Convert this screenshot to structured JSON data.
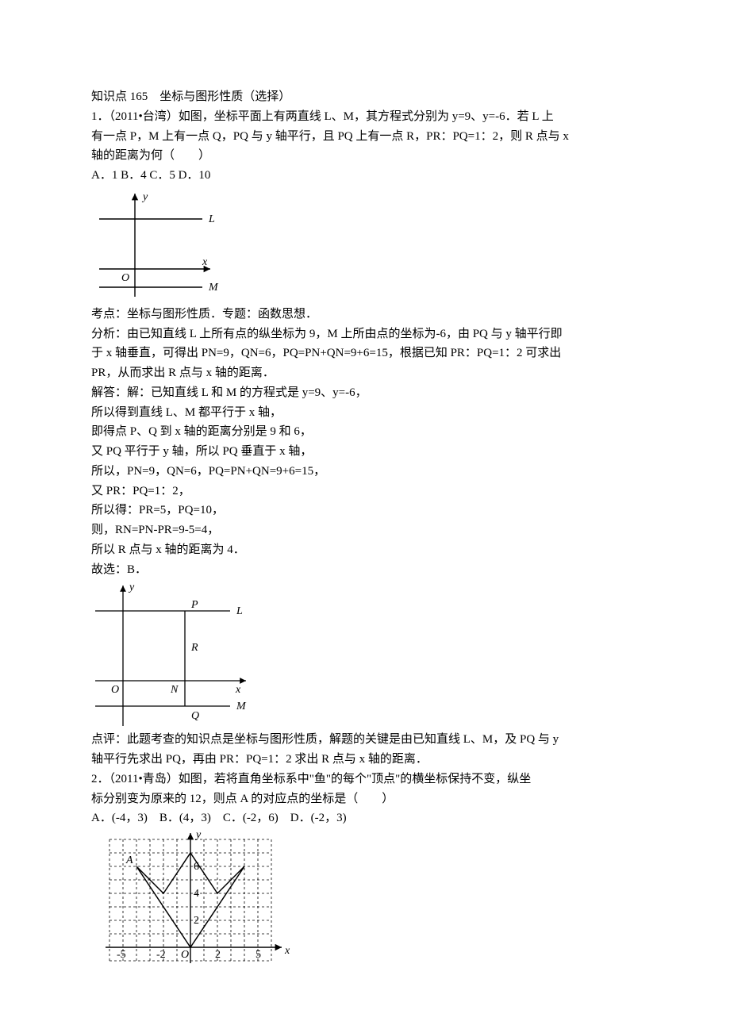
{
  "header": "知识点 165　坐标与图形性质（选择）",
  "q1": {
    "stem1": "1．（2011•台湾）如图，坐标平面上有两直线 L、M，其方程式分别为 y=9、y=-6．若 L 上",
    "stem2": "有一点 P，M 上有一点 Q，PQ 与 y 轴平行，且 PQ 上有一点 R，PR：PQ=1：2，则 R 点与 x",
    "stem3": "轴的距离为何（　　）",
    "opts": "A．1  B．4  C．5  D．10",
    "fig1": {
      "y": "y",
      "x": "x",
      "O": "O",
      "L": "L",
      "M": "M"
    },
    "exp_topic": "考点：坐标与图形性质．专题：函数思想．",
    "exp_an1": "分析：由已知直线 L 上所有点的纵坐标为 9，M 上所由点的坐标为-6，由 PQ 与 y 轴平行即",
    "exp_an2": "于 x 轴垂直，可得出 PN=9，QN=6，PQ=PN+QN=9+6=15，根据已知 PR：PQ=1：2 可求出",
    "exp_an3": "PR，从而求出 R 点与 x 轴的距离．",
    "sol1": "解答：解：已知直线 L 和 M 的方程式是 y=9、y=-6，",
    "sol2": "所以得到直线 L、M 都平行于 x 轴，",
    "sol3": "即得点 P、Q 到 x 轴的距离分别是 9 和 6，",
    "sol4": "又 PQ 平行于 y 轴，所以 PQ 垂直于 x 轴，",
    "sol5": "所以，PN=9，QN=6，PQ=PN+QN=9+6=15，",
    "sol6": "又 PR：PQ=1：2，",
    "sol7": "所以得：PR=5，PQ=10，",
    "sol8": "则，RN=PN-PR=9-5=4，",
    "sol9": "所以 R 点与 x 轴的距离为 4．",
    "sol10": "故选：B．",
    "fig2": {
      "y": "y",
      "x": "x",
      "O": "O",
      "L": "L",
      "M": "M",
      "P": "P",
      "R": "R",
      "N": "N",
      "Q": "Q"
    },
    "comment1": "点评：此题考查的知识点是坐标与图形性质，解题的关键是由已知直线 L、M，及 PQ 与 y",
    "comment2": "轴平行先求出 PQ，再由 PR：PQ=1：2 求出 R 点与 x 轴的距离．"
  },
  "q2": {
    "stem1": "2．（2011•青岛）如图，若将直角坐标系中\"鱼\"的每个\"顶点\"的横坐标保持不变，纵坐",
    "stem2": "标分别变为原来的 12，则点 A 的对应点的坐标是（　　）",
    "opts": "A．(-4，3)　B．(4，3)　C．(-2，6)　D．(-2，3)",
    "fig": {
      "y": "y",
      "x": "x",
      "O": "O",
      "A": "A",
      "xticks": [
        "-5",
        "-2",
        "2",
        "5"
      ],
      "yticks": [
        "2",
        "4",
        "6"
      ]
    }
  },
  "chart_data": [
    {
      "type": "diagram",
      "title": "Figure 1 – two horizontal lines",
      "axes": {
        "x": "x",
        "y": "y"
      },
      "lines": [
        {
          "name": "L",
          "equation": "y = 9",
          "position": "above x-axis"
        },
        {
          "name": "M",
          "equation": "y = -6",
          "position": "below x-axis"
        }
      ]
    },
    {
      "type": "diagram",
      "title": "Figure 2 – lines L, M with points P, R, N, Q on vertical segment",
      "axes": {
        "x": "x",
        "y": "y"
      },
      "lines": [
        {
          "name": "L",
          "equation": "y = 9"
        },
        {
          "name": "M",
          "equation": "y = -6"
        }
      ],
      "points": [
        {
          "name": "P",
          "on": "L",
          "y": 9
        },
        {
          "name": "R",
          "y": 4
        },
        {
          "name": "N",
          "y": 0,
          "on": "x-axis"
        },
        {
          "name": "Q",
          "on": "M",
          "y": -6
        }
      ]
    },
    {
      "type": "diagram",
      "title": "Figure 3 – fish on grid",
      "axes": {
        "x": "x",
        "y": "y"
      },
      "x_ticks": [
        -5,
        -2,
        0,
        2,
        5
      ],
      "y_ticks": [
        2,
        4,
        6
      ],
      "grid_range": {
        "x": [
          -6,
          6
        ],
        "y": [
          -1,
          8
        ]
      },
      "fish_vertices": [
        {
          "x": 0,
          "y": 0
        },
        {
          "x": -4,
          "y": 6,
          "label": "A"
        },
        {
          "x": -2,
          "y": 4
        },
        {
          "x": 0,
          "y": 7
        },
        {
          "x": 2,
          "y": 4
        },
        {
          "x": 4,
          "y": 6
        },
        {
          "x": 0,
          "y": 0
        }
      ]
    }
  ]
}
